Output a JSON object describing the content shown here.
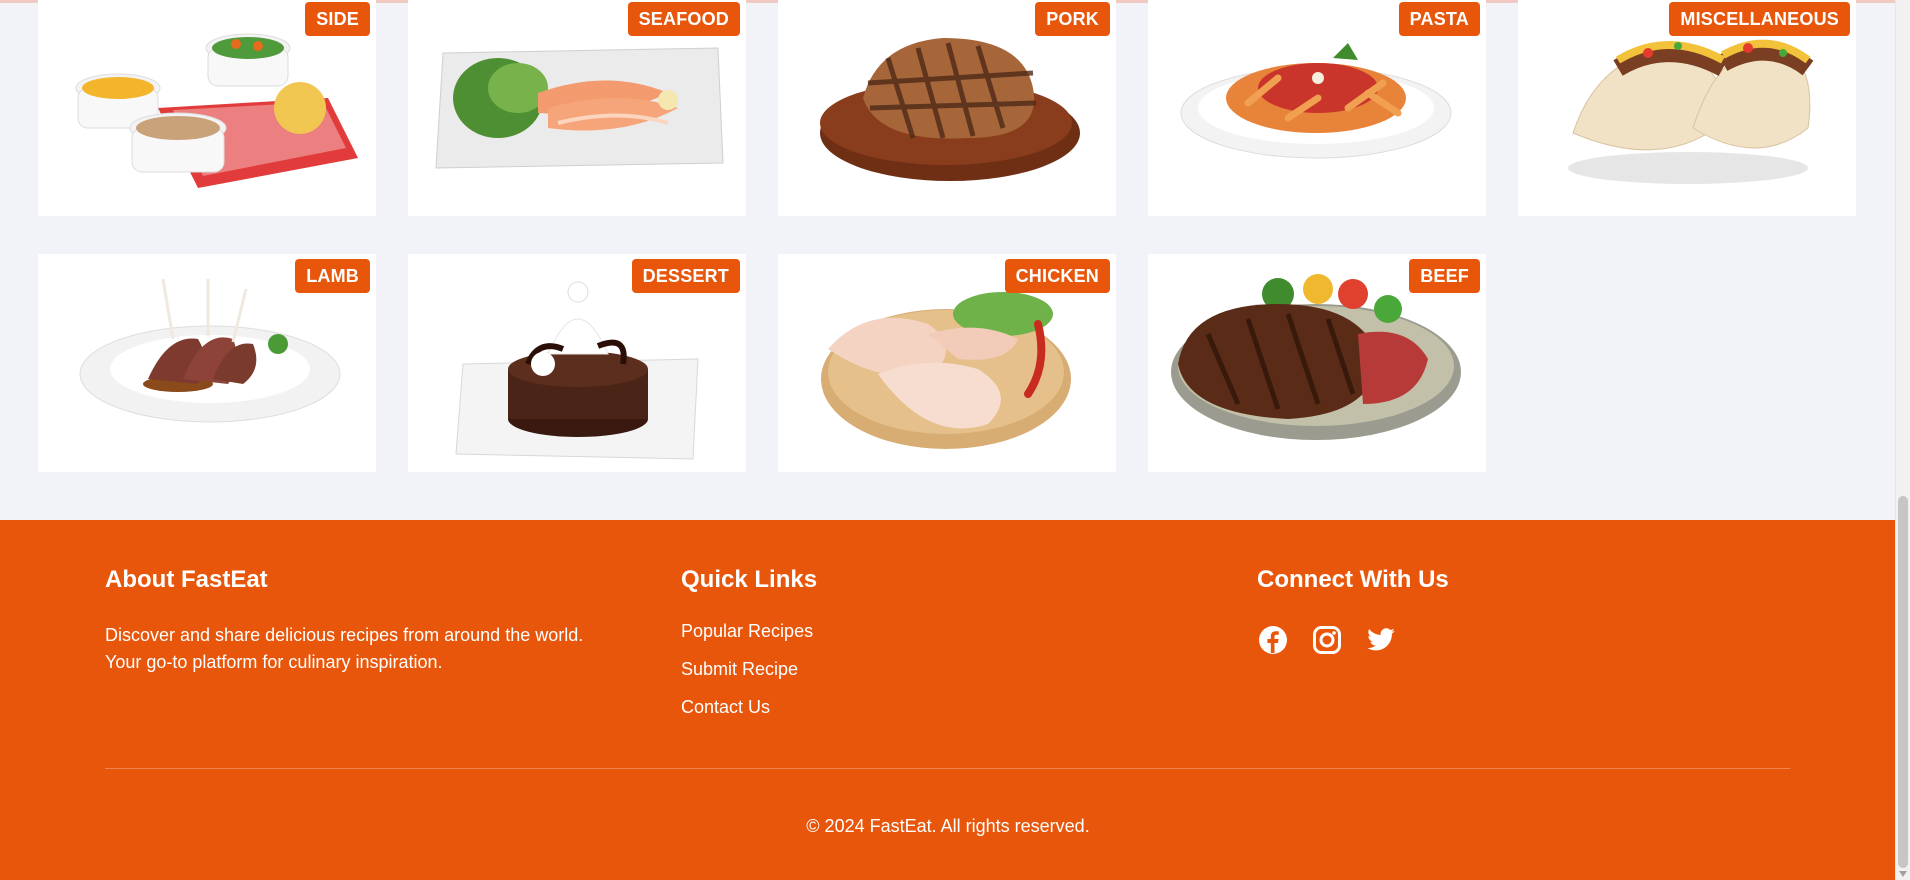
{
  "categories": [
    {
      "label": "SIDE"
    },
    {
      "label": "SEAFOOD"
    },
    {
      "label": "PORK"
    },
    {
      "label": "PASTA"
    },
    {
      "label": "MISCELLANEOUS"
    },
    {
      "label": "LAMB"
    },
    {
      "label": "DESSERT"
    },
    {
      "label": "CHICKEN"
    },
    {
      "label": "BEEF"
    }
  ],
  "footer": {
    "about": {
      "title": "About FastEat",
      "line1": "Discover and share delicious recipes from around the world.",
      "line2": "Your go-to platform for culinary inspiration."
    },
    "quick_links": {
      "title": "Quick Links",
      "items": [
        "Popular Recipes",
        "Submit Recipe",
        "Contact Us"
      ]
    },
    "connect": {
      "title": "Connect With Us",
      "icons": [
        "facebook-icon",
        "instagram-icon",
        "twitter-icon"
      ]
    },
    "copyright": "© 2024 FastEat. All rights reserved."
  },
  "colors": {
    "accent": "#e8560b",
    "page_bg": "#f1f3f8",
    "card_bg": "#ffffff"
  }
}
